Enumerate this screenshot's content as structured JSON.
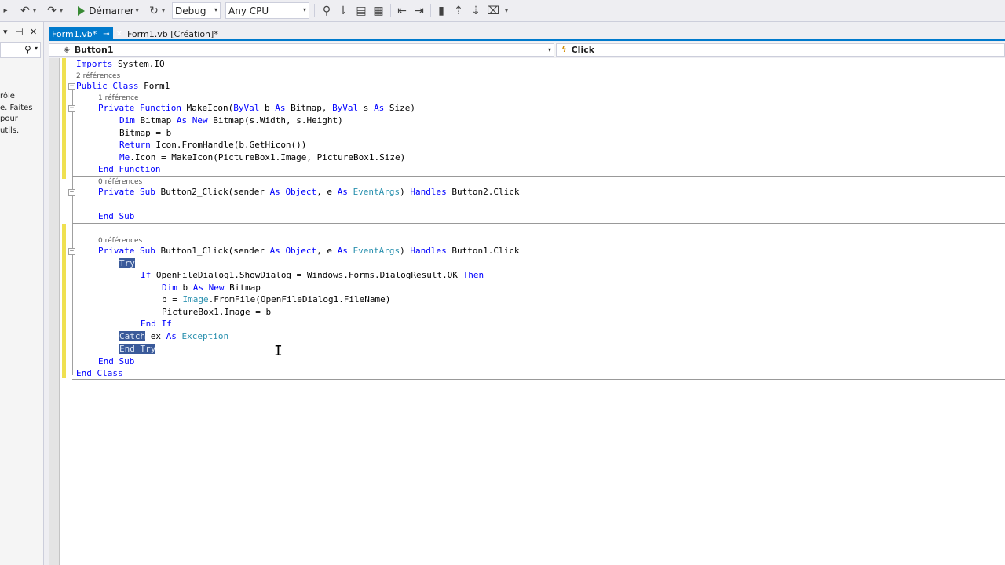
{
  "toolbar": {
    "start_label": "Démarrer",
    "config_value": "Debug",
    "platform_value": "Any CPU",
    "icons": [
      "undo-icon",
      "redo-icon",
      "start-icon",
      "attach-icon",
      "find-icon",
      "bookmark-icon"
    ]
  },
  "left_panel": {
    "text_lines": [
      "rôle",
      "e. Faites",
      "pour",
      "utils."
    ]
  },
  "tabs": [
    {
      "label": "Form1.vb*",
      "active": true
    },
    {
      "label": "Form1.vb [Création]*",
      "active": false
    }
  ],
  "navbar": {
    "class_combo": "Button1",
    "member_combo": "Click"
  },
  "code": {
    "l1": "Imports System.IO",
    "lens1": "2 références",
    "lens2": "1 référence",
    "lens3": "0 références",
    "lens4": "0 références",
    "dim_bitmap_args": "(s.Width, s.Height)",
    "return_expr": " Icon.FromHandle(b.GetHicon())",
    "me_icon": ".Icon = MakeIcon(PictureBox1.Image, PictureBox1.Size)",
    "try_kw": "Try",
    "if_cond": " OpenFileDialog1.ShowDialog = Windows.Forms.DialogResult.OK ",
    "catch_kw": "Catch",
    "catch_var": " ex ",
    "end_try": "End Try"
  },
  "colors": {
    "accent": "#007acc",
    "keyword": "#0000ff",
    "type": "#2b91af",
    "selection": "#3a5a9a",
    "changebar_yellow": "#efe050"
  }
}
